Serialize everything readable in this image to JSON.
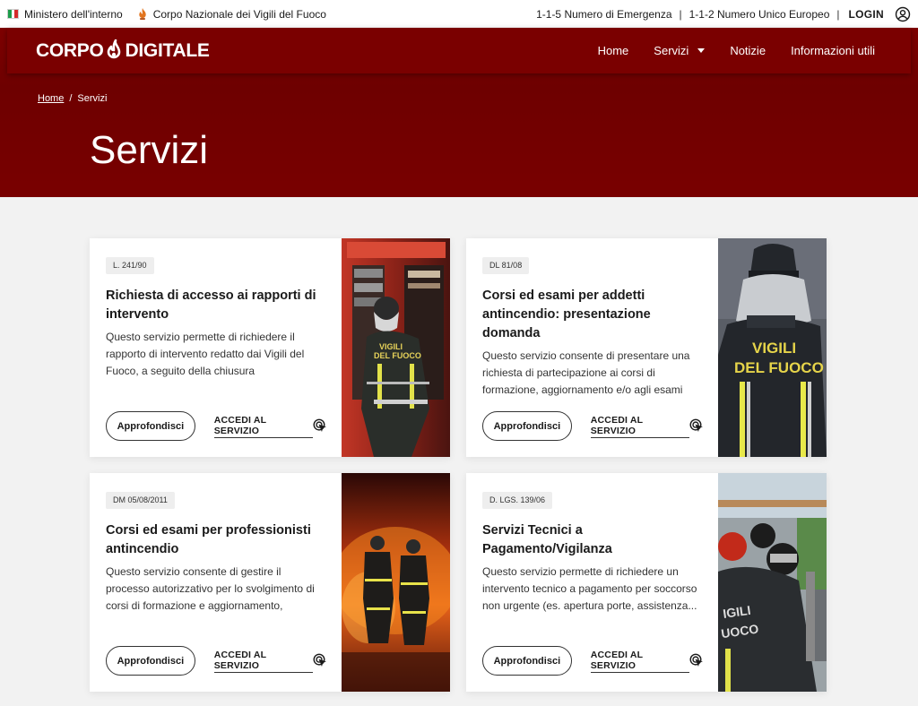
{
  "topbar": {
    "ministry": "Ministero dell'interno",
    "corps": "Corpo Nazionale dei Vigili del Fuoco",
    "emergency": "1-1-5 Numero di Emergenza",
    "separator": "|",
    "european": "1-1-2 Numero Unico Europeo",
    "login": "LOGIN"
  },
  "brand": {
    "part1": "CORPO",
    "part2": "DIGITALE"
  },
  "nav": {
    "home": "Home",
    "services": "Servizi",
    "news": "Notizie",
    "info": "Informazioni utili"
  },
  "breadcrumb": {
    "home": "Home",
    "separator": "/",
    "current": "Servizi"
  },
  "page": {
    "title": "Servizi"
  },
  "cards": [
    {
      "tag": "L. 241/90",
      "title": "Richiesta di accesso ai rapporti di intervento",
      "description": "Questo servizio permette di richiedere il rapporto di intervento redatto dai Vigili del Fuoco, a seguito della chiusura dell'intervento...",
      "more_label": "Approfondisci",
      "access_label": "ACCEDI AL SERVIZIO"
    },
    {
      "tag": "DL 81/08",
      "title": "Corsi ed esami per addetti antincendio: presentazione domanda",
      "description": "Questo servizio consente di presentare una richiesta di partecipazione ai corsi di formazione, aggiornamento e/o agli esami di...",
      "more_label": "Approfondisci",
      "access_label": "ACCEDI AL SERVIZIO",
      "image_text": "VIGILI\nDEL FUOCO"
    },
    {
      "tag": "DM 05/08/2011",
      "title": "Corsi ed esami per professionisti antincendio",
      "description": "Questo servizio consente di gestire il processo autorizzativo per lo svolgimento di corsi di formazione e aggiornamento, seminari ed...",
      "more_label": "Approfondisci",
      "access_label": "ACCEDI AL SERVIZIO"
    },
    {
      "tag": "D. LGS. 139/06",
      "title": "Servizi Tecnici a Pagamento/Vigilanza",
      "description": "Questo servizio permette di richiedere un intervento tecnico a pagamento per soccorso non urgente (es. apertura porte, assistenza...",
      "more_label": "Approfondisci",
      "access_label": "ACCEDI AL SERVIZIO"
    }
  ],
  "colors": {
    "primary": "#7a0000",
    "hero_dark": "#6e0000",
    "background": "#f2f2f2"
  },
  "icons": [
    "italy-flag-icon",
    "flame-icon",
    "user-circle-icon",
    "caret-down-icon",
    "cursor-click-icon"
  ]
}
